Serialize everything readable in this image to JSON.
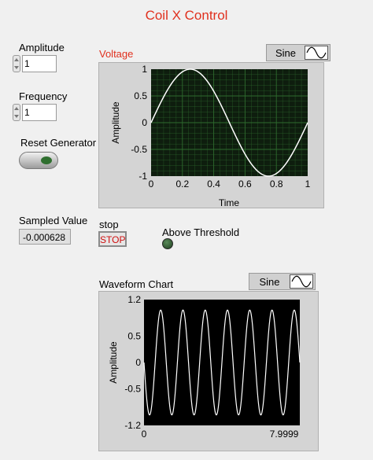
{
  "title": "Coil X Control",
  "amplitude": {
    "label": "Amplitude",
    "value": "1"
  },
  "frequency": {
    "label": "Frequency",
    "value": "1"
  },
  "reset": {
    "label": "Reset Generator"
  },
  "sampled": {
    "label": "Sampled Value",
    "value": "-0.000628"
  },
  "stop": {
    "label": "stop",
    "button": "STOP"
  },
  "threshold": {
    "label": "Above Threshold"
  },
  "voltage_graph": {
    "title": "Voltage",
    "legend": "Sine",
    "xlabel": "Time",
    "ylabel": "Amplitude",
    "xticks": [
      "0",
      "0.2",
      "0.4",
      "0.6",
      "0.8",
      "1"
    ],
    "yticks": [
      "1",
      "0.5",
      "0",
      "-0.5",
      "-1"
    ]
  },
  "waveform_chart": {
    "title": "Waveform Chart",
    "legend": "Sine",
    "ylabel": "Amplitude",
    "yticks": [
      "1.2",
      "0.5",
      "0",
      "-0.5",
      "-1.2"
    ],
    "xticks": [
      "0",
      "7.9999"
    ]
  },
  "colors": {
    "title": "#e0301e",
    "plot_bg": "#0e1d0e",
    "grid": "#2e6a2e",
    "trace": "#ffffff"
  },
  "chart_data": [
    {
      "type": "line",
      "title": "Voltage",
      "xlabel": "Time",
      "ylabel": "Amplitude",
      "xlim": [
        0,
        1
      ],
      "ylim": [
        -1,
        1
      ],
      "grid": true,
      "series": [
        {
          "name": "Sine",
          "function": "sine",
          "amplitude": 1,
          "frequency": 1
        }
      ]
    },
    {
      "type": "line",
      "title": "Waveform Chart",
      "ylabel": "Amplitude",
      "xlim": [
        0,
        7.9999
      ],
      "ylim": [
        -1.2,
        1.2
      ],
      "grid": false,
      "series": [
        {
          "name": "Sine",
          "function": "sine",
          "amplitude": 1,
          "cycles": 7
        }
      ]
    }
  ]
}
